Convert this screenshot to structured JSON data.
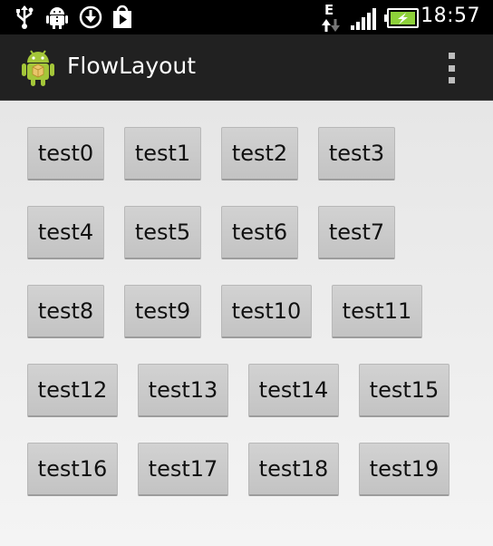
{
  "status_bar": {
    "time": "18:57",
    "network_type": "E",
    "icons": [
      "usb-icon",
      "android-debug-icon",
      "download-icon",
      "play-store-icon",
      "data-activity-icon",
      "signal-icon",
      "battery-charging-icon"
    ]
  },
  "action_bar": {
    "title": "FlowLayout",
    "app_icon": "android-robot-icon",
    "overflow_icon": "overflow-menu-icon"
  },
  "tags": [
    "test0",
    "test1",
    "test2",
    "test3",
    "test4",
    "test5",
    "test6",
    "test7",
    "test8",
    "test9",
    "test10",
    "test11",
    "test12",
    "test13",
    "test14",
    "test15",
    "test16",
    "test17",
    "test18",
    "test19"
  ],
  "colors": {
    "action_bar": "#212121",
    "status_bar": "#000000",
    "tag_background": "#c8c8c8",
    "battery": "#8ed13a"
  }
}
